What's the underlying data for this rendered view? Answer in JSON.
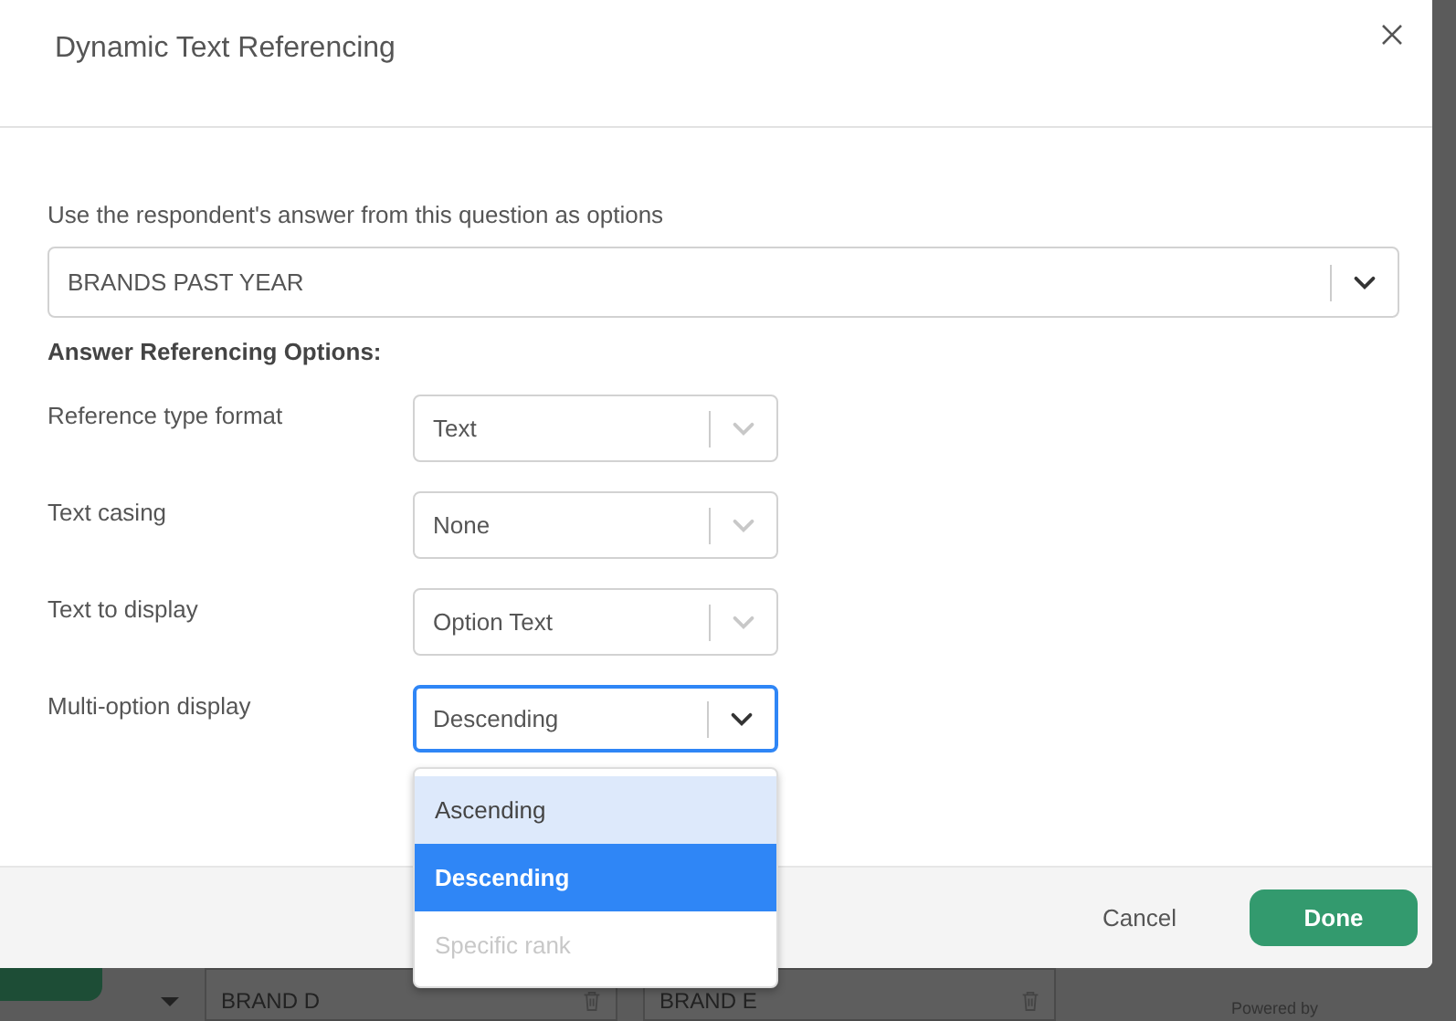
{
  "background_page": {
    "rows": [
      {
        "cell_1": "BRAND D",
        "cell_2": "BRAND E"
      }
    ],
    "footer_text": "Powered by"
  },
  "dialog": {
    "title": "Dynamic Text Referencing",
    "source_question": {
      "label": "Use the respondent's answer from this question as options",
      "value": "BRANDS PAST YEAR"
    },
    "section_heading": "Answer Referencing Options:",
    "options": [
      {
        "label": "Reference type format",
        "value": "Text",
        "open": false
      },
      {
        "label": "Text casing",
        "value": "None",
        "open": false
      },
      {
        "label": "Text to display",
        "value": "Option Text",
        "open": false
      },
      {
        "label": "Multi-option display",
        "value": "Descending",
        "open": true,
        "menu": [
          {
            "label": "Ascending",
            "selected": false,
            "highlighted": true,
            "disabled": false
          },
          {
            "label": "Descending",
            "selected": true,
            "highlighted": false,
            "disabled": false
          },
          {
            "label": "Specific rank",
            "selected": false,
            "highlighted": false,
            "disabled": true
          }
        ]
      }
    ],
    "buttons": [
      {
        "label": "Cancel",
        "kind": "secondary"
      },
      {
        "label": "Done",
        "kind": "primary"
      }
    ]
  }
}
